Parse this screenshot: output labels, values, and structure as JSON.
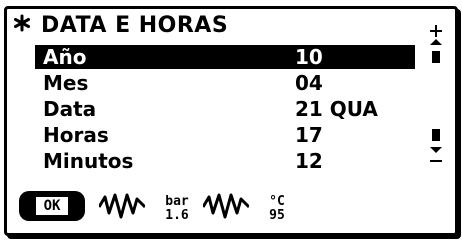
{
  "header": {
    "title": "DATA E HORAS",
    "star_icon": "asterisk-icon"
  },
  "menu": {
    "items": [
      {
        "label": "Año",
        "value": "10",
        "selected": true
      },
      {
        "label": "Mes",
        "value": "04",
        "selected": false
      },
      {
        "label": "Data",
        "value": "21 QUA",
        "selected": false
      },
      {
        "label": "Horas",
        "value": "17",
        "selected": false
      },
      {
        "label": "Minutos",
        "value": "12",
        "selected": false
      }
    ]
  },
  "softkeys": {
    "ok_label": "OK",
    "pressure_unit": "bar",
    "pressure_value": "1.6",
    "temp_unit": "°C",
    "temp_value": "95"
  }
}
